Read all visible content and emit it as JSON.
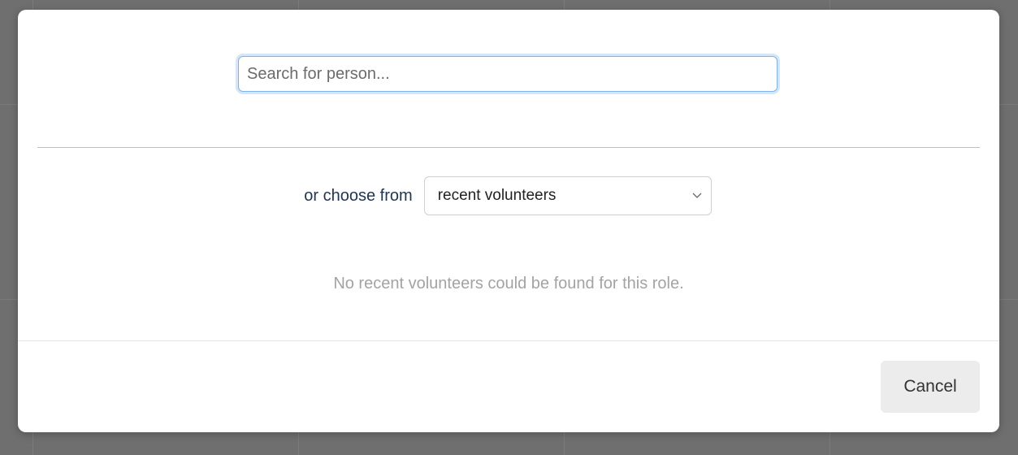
{
  "search": {
    "placeholder": "Search for person...",
    "value": ""
  },
  "chooser": {
    "label": "or choose from",
    "selected": "recent volunteers",
    "chevron_icon": "chevron-down-icon"
  },
  "empty_state": {
    "message": "No recent volunteers could be found for this role."
  },
  "footer": {
    "cancel_label": "Cancel"
  }
}
